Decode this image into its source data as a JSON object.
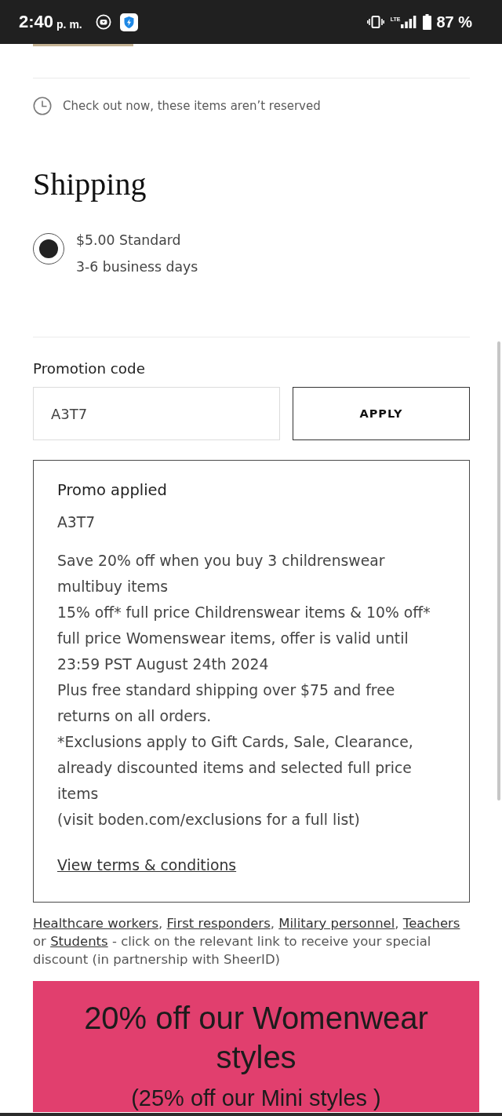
{
  "status_bar": {
    "time": "2:40",
    "time_period": "p. m.",
    "network": "LTE",
    "battery": "87 %"
  },
  "reservation_notice": {
    "text": "Check out now, these items aren’t reserved"
  },
  "shipping": {
    "title": "Shipping",
    "options": [
      {
        "label": "$5.00 Standard",
        "delivery": "3-6 business days",
        "selected": true
      }
    ]
  },
  "promotion_code": {
    "label": "Promotion code",
    "value": "A3T7",
    "apply_button": "APPLY"
  },
  "promo_applied": {
    "title": "Promo applied",
    "code": "A3T7",
    "description": [
      "Save 20% off when you buy 3 childrenswear multibuy items",
      "15% off* full price Childrenswear items & 10% off* full price Womenswear items, offer is valid until 23:59 PST August 24th 2024",
      "Plus free standard shipping over $75 and free returns on all orders.",
      "*Exclusions apply to Gift Cards, Sale, Clearance, already discounted items and selected full price items",
      "(visit boden.com/exclusions for a full list)"
    ],
    "terms_link": "View terms & conditions"
  },
  "discount_notice": {
    "segments": [
      {
        "kind": "link",
        "text": "Healthcare workers"
      },
      {
        "kind": "text",
        "text": ", "
      },
      {
        "kind": "link",
        "text": "First responders"
      },
      {
        "kind": "text",
        "text": ", "
      },
      {
        "kind": "link",
        "text": "Military personnel"
      },
      {
        "kind": "text",
        "text": ", "
      },
      {
        "kind": "link",
        "text": "Teachers"
      },
      {
        "kind": "text",
        "text": " or "
      },
      {
        "kind": "link",
        "text": "Students"
      },
      {
        "kind": "text",
        "text": " - click on the relevant link to receive your special discount (in partnership with SheerID)"
      }
    ]
  },
  "banner": {
    "headline": "20% off our Womenwear styles",
    "subline": "(25% off our Mini styles )"
  }
}
